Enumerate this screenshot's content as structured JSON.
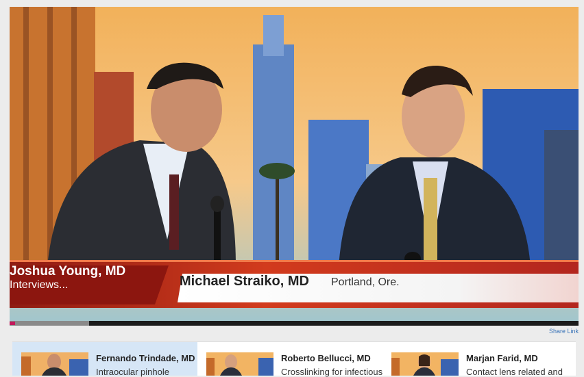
{
  "video": {
    "host_name": "Joshua Young, MD",
    "host_subtitle": "Interviews...",
    "guest_name": "Michael Straiko, MD",
    "guest_location": "Portland, Ore.",
    "progress": 0.14
  },
  "share_link": "Share Link",
  "playlist": [
    {
      "name": "Fernando Trindade, MD",
      "desc": "Intraocular pinhole",
      "active": true
    },
    {
      "name": "Roberto Bellucci, MD",
      "desc": "Crosslinking for infectious",
      "active": false
    },
    {
      "name": "Marjan Farid, MD",
      "desc": "Contact lens related and",
      "active": false
    }
  ],
  "colors": {
    "accent": "#c2185b",
    "link": "#3a74b8",
    "banner": "#b3261e"
  }
}
